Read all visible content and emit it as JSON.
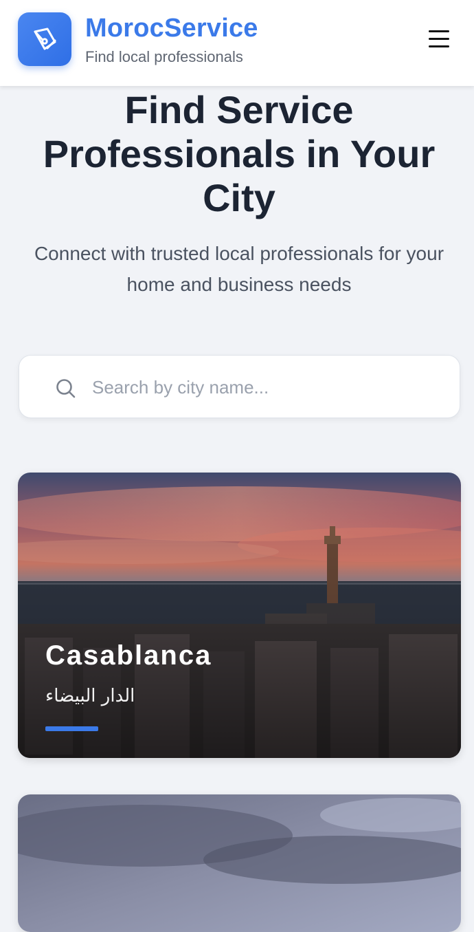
{
  "header": {
    "brand_name": "MorocService",
    "tagline": "Find local professionals",
    "logo_icon": "pen-tool-icon",
    "menu_icon": "hamburger-menu-icon"
  },
  "hero": {
    "title": "Find Service Professionals in Your City",
    "subtitle": "Connect with trusted local professionals for your home and business needs"
  },
  "search": {
    "placeholder": "Search by city name...",
    "value": "",
    "icon": "search-icon"
  },
  "cities": [
    {
      "name": "Casablanca",
      "name_ar": "الدار البيضاء"
    },
    {
      "name": "",
      "name_ar": ""
    }
  ],
  "colors": {
    "accent": "#3b7ae9",
    "title": "#1c2433",
    "background": "#f1f3f7"
  }
}
